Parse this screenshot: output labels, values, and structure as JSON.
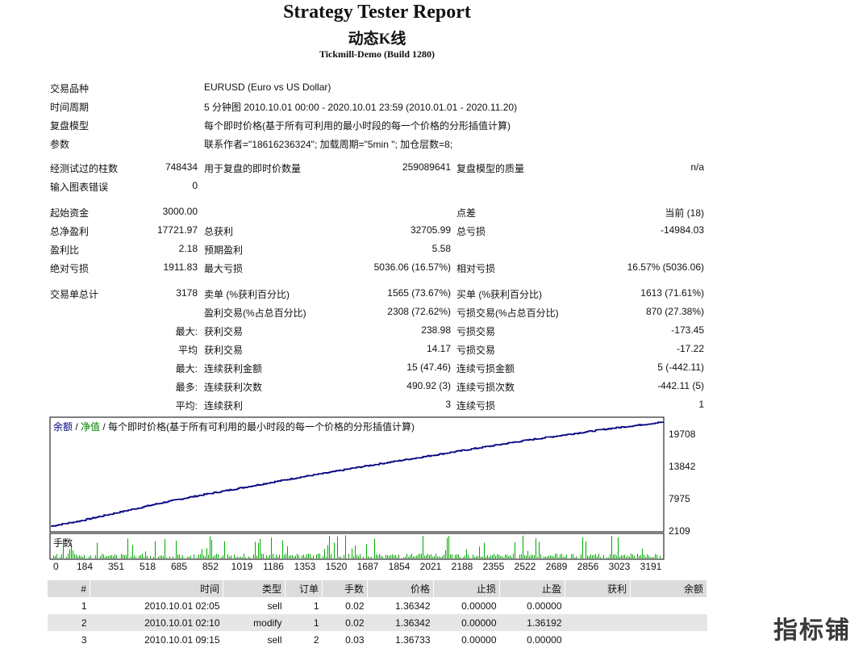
{
  "header": {
    "title": "Strategy Tester Report",
    "subtitle": "动态K线",
    "server": "Tickmill-Demo (Build 1280)"
  },
  "info": {
    "symbol_label": "交易品种",
    "symbol_value": "EURUSD (Euro vs US Dollar)",
    "period_label": "时间周期",
    "period_value": "5 分钟图 2010.10.01 00:00 - 2020.10.01 23:59 (2010.01.01 - 2020.11.20)",
    "model_label": "复盘模型",
    "model_value": "每个即时价格(基于所有可利用的最小时段的每一个价格的分形插值计算)",
    "params_label": "参数",
    "params_value": "联系作者=\"18616236324\"; 加载周期=\"5min \"; 加仓层数=8;"
  },
  "stats": {
    "bars_label": "经测试过的柱数",
    "bars_value": "748434",
    "ticks_label": "用于复盘的即时价数量",
    "ticks_value": "259089641",
    "quality_label": "复盘模型的质量",
    "quality_value": "n/a",
    "errors_label": "输入图表错误",
    "errors_value": "0",
    "deposit_label": "起始资金",
    "deposit_value": "3000.00",
    "spread_label": "点差",
    "spread_value": "当前 (18)",
    "net_label": "总净盈利",
    "net_value": "17721.97",
    "gross_profit_label": "总获利",
    "gross_profit_value": "32705.99",
    "gross_loss_label": "总亏损",
    "gross_loss_value": "-14984.03",
    "pf_label": "盈利比",
    "pf_value": "2.18",
    "expected_label": "预期盈利",
    "expected_value": "5.58",
    "abs_dd_label": "绝对亏损",
    "abs_dd_value": "1911.83",
    "max_dd_label": "最大亏损",
    "max_dd_value": "5036.06 (16.57%)",
    "rel_dd_label": "相对亏损",
    "rel_dd_value": "16.57% (5036.06)",
    "trades_label": "交易单总计",
    "trades_value": "3178",
    "short_label": "卖单 (%获利百分比)",
    "short_value": "1565 (73.67%)",
    "long_label": "买单 (%获利百分比)",
    "long_value": "1613 (71.61%)",
    "profit_trades_label": "盈利交易(%占总百分比)",
    "profit_trades_value": "2308 (72.62%)",
    "loss_trades_label": "亏损交易(%占总百分比)",
    "loss_trades_value": "870 (27.38%)",
    "max_prefix": "最大:",
    "avg_prefix": "平均",
    "most_prefix": "最多:",
    "avg2_prefix": "平均:",
    "largest_profit_label": "获利交易",
    "largest_profit_value": "238.98",
    "largest_loss_label": "亏损交易",
    "largest_loss_value": "-173.45",
    "avg_profit_label": "获利交易",
    "avg_profit_value": "14.17",
    "avg_loss_label": "亏损交易",
    "avg_loss_value": "-17.22",
    "max_cons_win_label": "连续获利金额",
    "max_cons_win_value": "15 (47.46)",
    "max_cons_loss_label": "连续亏损金额",
    "max_cons_loss_value": "5 (-442.11)",
    "most_cons_profit_label": "连续获利次数",
    "most_cons_profit_value": "490.92 (3)",
    "most_cons_loss_label": "连续亏损次数",
    "most_cons_loss_value": "-442.11 (5)",
    "avg_cons_win_label": "连续获利",
    "avg_cons_win_value": "3",
    "avg_cons_loss_label": "连续亏损",
    "avg_cons_loss_value": "1"
  },
  "chart_data": {
    "type": "line",
    "legend": {
      "balance": "余额",
      "sep": " / ",
      "equity": "净值",
      "desc": " / 每个即时价格(基于所有可利用的最小时段的每一个价格的分形插值计算)"
    },
    "series": [
      {
        "name": "余额",
        "color": "#000080",
        "values": [
          2109,
          3000,
          4100,
          5200,
          6300,
          7300,
          8200,
          9100,
          10000,
          10900,
          11700,
          12600,
          13400,
          14200,
          15000,
          15800,
          16600,
          17400,
          18100,
          18800,
          19500,
          20100,
          20723
        ]
      }
    ],
    "x_ticks": [
      "0",
      "184",
      "351",
      "518",
      "685",
      "852",
      "1019",
      "1186",
      "1353",
      "1520",
      "1687",
      "1854",
      "2021",
      "2188",
      "2355",
      "2522",
      "2689",
      "2856",
      "3023",
      "3191"
    ],
    "y_ticks": [
      "19708",
      "13842",
      "7975",
      "2109"
    ],
    "ylim": [
      2109,
      19708
    ],
    "xlim": [
      0,
      3191
    ],
    "volume_label": "手数",
    "volume_color": "#00aa00",
    "accent_color": "#008000"
  },
  "orders": {
    "headers": [
      "#",
      "时间",
      "类型",
      "订单",
      "手数",
      "价格",
      "止损",
      "止盈",
      "获利",
      "余额"
    ],
    "rows": [
      [
        "1",
        "2010.10.01 02:05",
        "sell",
        "1",
        "0.02",
        "1.36342",
        "0.00000",
        "0.00000",
        "",
        ""
      ],
      [
        "2",
        "2010.10.01 02:10",
        "modify",
        "1",
        "0.02",
        "1.36342",
        "0.00000",
        "1.36192",
        "",
        ""
      ],
      [
        "3",
        "2010.10.01 09:15",
        "sell",
        "2",
        "0.03",
        "1.36733",
        "0.00000",
        "0.00000",
        "",
        ""
      ]
    ]
  },
  "watermark": "指标铺"
}
